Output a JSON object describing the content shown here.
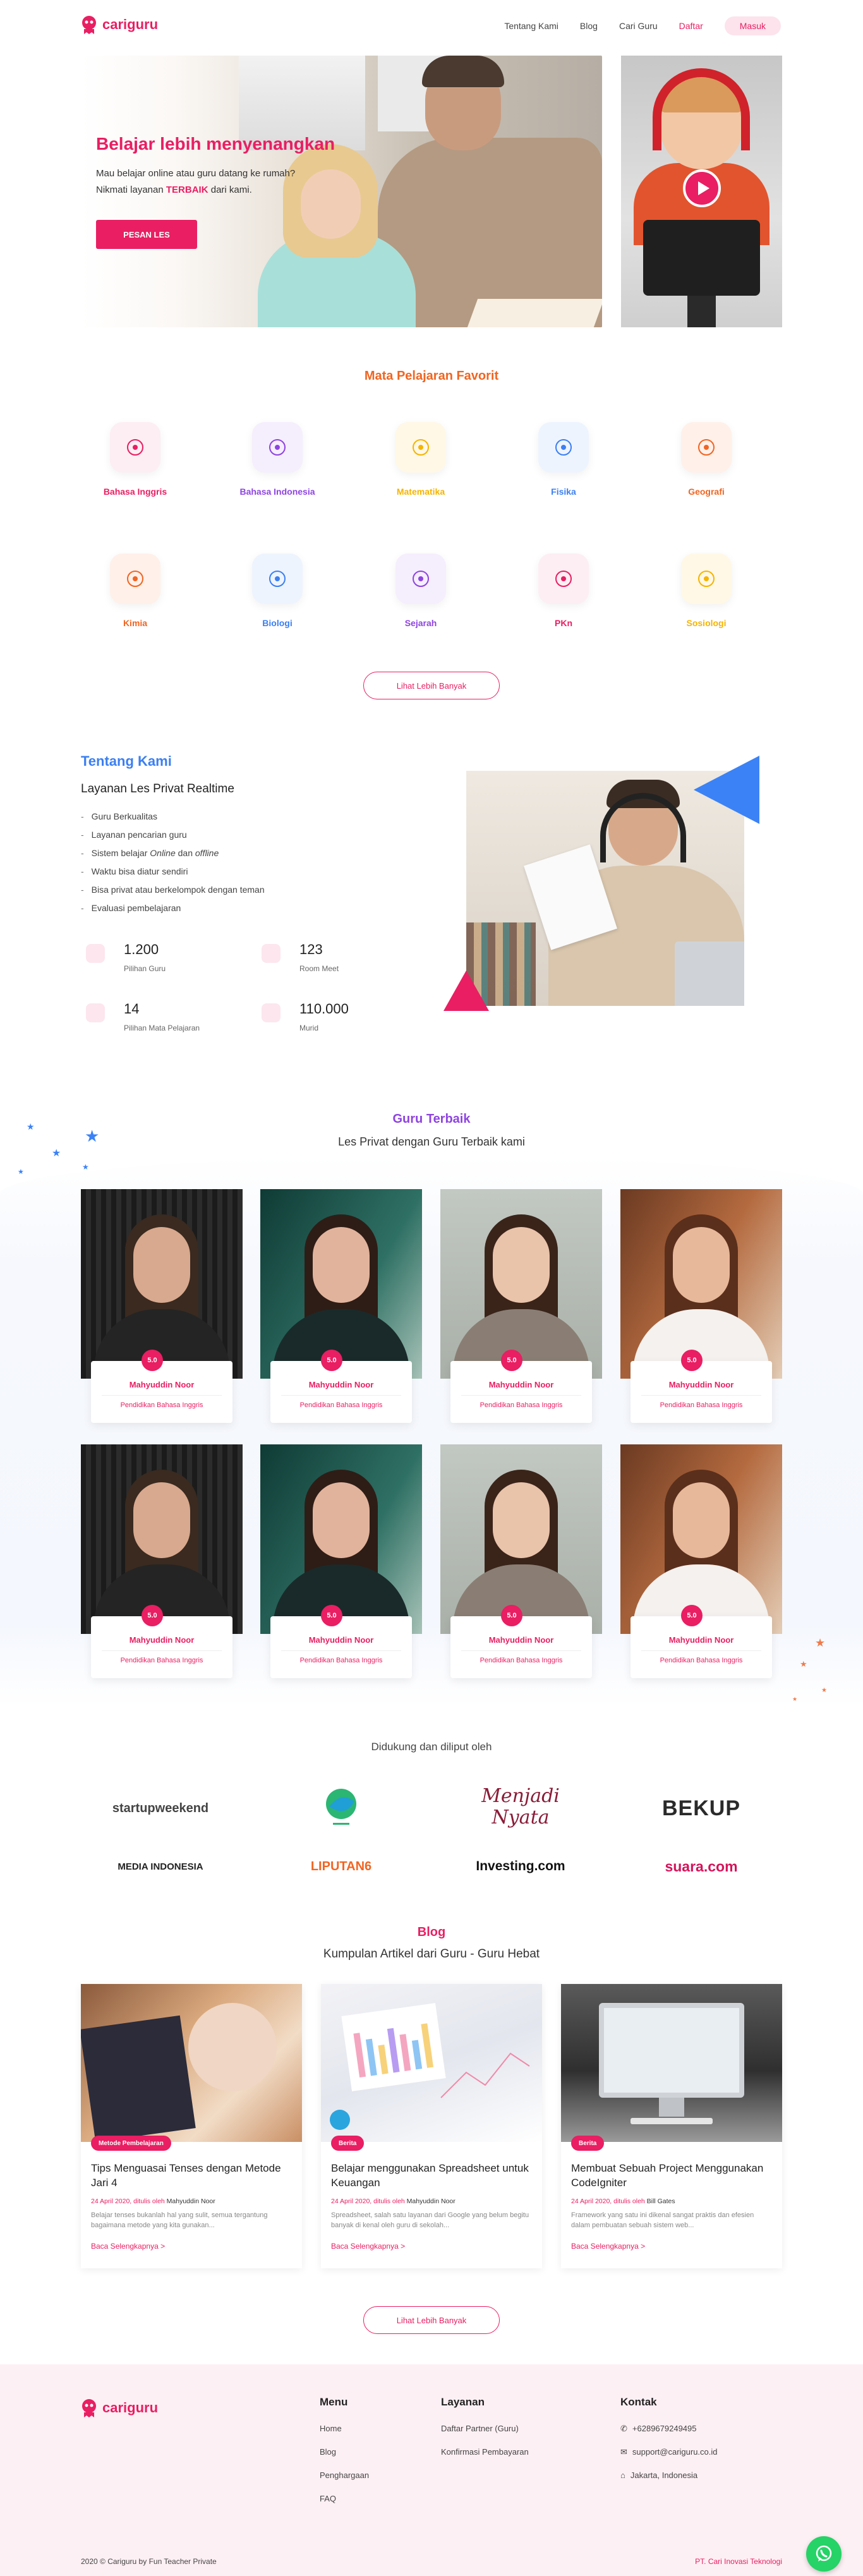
{
  "brand": {
    "name": "cariguru",
    "color": "#e91e63"
  },
  "nav": {
    "items": [
      "Tentang Kami",
      "Blog",
      "Cari Guru"
    ],
    "daftar": "Daftar",
    "masuk": "Masuk"
  },
  "hero": {
    "title": "Belajar lebih menyenangkan",
    "line1": "Mau belajar online atau guru datang ke rumah?",
    "line2_pre": "Nikmati layanan ",
    "line2_bold": "TERBAIK",
    "line2_post": " dari kami.",
    "button": "PESAN LES"
  },
  "video": {
    "play_icon": "play-icon"
  },
  "subjects": {
    "title": "Mata Pelajaran Favorit",
    "items": [
      {
        "label": "Bahasa Inggris",
        "icon": "english-bubble-icon",
        "color": "#e91e63",
        "bg": "#fdeef3"
      },
      {
        "label": "Bahasa Indonesia",
        "icon": "indonesia-bubble-icon",
        "color": "#8e44e0",
        "bg": "#f5eefd"
      },
      {
        "label": "Matematika",
        "icon": "calculator-icon",
        "color": "#f5b400",
        "bg": "#fff8e6"
      },
      {
        "label": "Fisika",
        "icon": "atom-icon",
        "color": "#3b7ff2",
        "bg": "#eef4fe"
      },
      {
        "label": "Geografi",
        "icon": "globe-icon",
        "color": "#f06522",
        "bg": "#fff0e9"
      },
      {
        "label": "Kimia",
        "icon": "flask-icon",
        "color": "#f06522",
        "bg": "#fff0e9"
      },
      {
        "label": "Biologi",
        "icon": "dna-icon",
        "color": "#3b7ff2",
        "bg": "#eef4fe"
      },
      {
        "label": "Sejarah",
        "icon": "history-search-icon",
        "color": "#8e44e0",
        "bg": "#f5eefd"
      },
      {
        "label": "PKn",
        "icon": "garuda-icon",
        "color": "#e91e63",
        "bg": "#fdeef3"
      },
      {
        "label": "Sosiologi",
        "icon": "network-icon",
        "color": "#f5b400",
        "bg": "#fff8e6"
      }
    ],
    "more": "Lihat Lebih Banyak"
  },
  "about": {
    "kicker": "Tentang Kami",
    "title": "Layanan Les Privat Realtime",
    "list": [
      "Guru Berkualitas",
      "Layanan pencarian guru",
      "Sistem belajar Online dan offline",
      "Waktu bisa diatur sendiri",
      "Bisa privat atau berkelompok dengan teman",
      "Evaluasi pembelajaran"
    ],
    "stats": [
      {
        "num": "1.200",
        "cap": "Pilihan Guru",
        "icon": "teacher-icon"
      },
      {
        "num": "123",
        "cap": "Room Meet",
        "icon": "room-icon"
      },
      {
        "num": "14",
        "cap": "Pilihan Mata Pelajaran",
        "icon": "board-icon"
      },
      {
        "num": "110.000",
        "cap": "Murid",
        "icon": "graduation-cap-icon"
      }
    ]
  },
  "teachers": {
    "title": "Guru Terbaik",
    "subtitle": "Les Privat dengan Guru Terbaik kami",
    "cards": [
      {
        "name": "Mahyuddin Noor",
        "subject": "Pendidikan Bahasa Inggris",
        "rating": "5.0"
      },
      {
        "name": "Mahyuddin Noor",
        "subject": "Pendidikan Bahasa Inggris",
        "rating": "5.0"
      },
      {
        "name": "Mahyuddin Noor",
        "subject": "Pendidikan Bahasa Inggris",
        "rating": "5.0"
      },
      {
        "name": "Mahyuddin Noor",
        "subject": "Pendidikan Bahasa Inggris",
        "rating": "5.0"
      },
      {
        "name": "Mahyuddin Noor",
        "subject": "Pendidikan Bahasa Inggris",
        "rating": "5.0"
      },
      {
        "name": "Mahyuddin Noor",
        "subject": "Pendidikan Bahasa Inggris",
        "rating": "5.0"
      },
      {
        "name": "Mahyuddin Noor",
        "subject": "Pendidikan Bahasa Inggris",
        "rating": "5.0"
      },
      {
        "name": "Mahyuddin Noor",
        "subject": "Pendidikan Bahasa Inggris",
        "rating": "5.0"
      }
    ]
  },
  "partners": {
    "title": "Didukung dan diliput oleh",
    "items": [
      "startupweekend",
      "Menjadi Nyata",
      "BEKUP",
      "MEDIA INDONESIA",
      "LIPUTAN6",
      "Investing.com",
      "suara.com"
    ]
  },
  "blog": {
    "kicker": "Blog",
    "subtitle": "Kumpulan Artikel dari Guru - Guru Hebat",
    "posts": [
      {
        "tag": "Metode Pembelajaran",
        "title": "Tips Menguasai Tenses dengan Metode Jari 4",
        "date": "24 April 2020, ditulis oleh ",
        "author": "Mahyuddin Noor",
        "excerpt": "Belajar tenses bukanlah hal yang sulit, semua tergantung bagaimana metode yang kita gunakan...",
        "more": "Baca Selengkapnya >"
      },
      {
        "tag": "Berita",
        "title": "Belajar menggunakan Spreadsheet untuk Keuangan",
        "date": "24 April 2020, ditulis oleh ",
        "author": "Mahyuddin Noor",
        "excerpt": "Spreadsheet, salah satu layanan dari Google yang belum begitu banyak di kenal oleh guru di sekolah...",
        "more": "Baca Selengkapnya >"
      },
      {
        "tag": "Berita",
        "title": "Membuat Sebuah Project Menggunakan CodeIgniter",
        "date": "24 April 2020, ditulis oleh ",
        "author": "Bill Gates",
        "excerpt": "Framework yang satu ini dikenal sangat praktis dan efesien dalam pembuatan sebuah sistem web...",
        "more": "Baca Selengkapnya >"
      }
    ],
    "more": "Lihat Lebih Banyak"
  },
  "footer": {
    "menu_title": "Menu",
    "menu": [
      "Home",
      "Blog",
      "Penghargaan",
      "FAQ"
    ],
    "layanan_title": "Layanan",
    "layanan": [
      "Daftar Partner (Guru)",
      "Konfirmasi Pembayaran"
    ],
    "kontak_title": "Kontak",
    "kontak": [
      {
        "icon": "phone-icon",
        "text": "+6289679249495"
      },
      {
        "icon": "mail-icon",
        "text": "support@cariguru.co.id"
      },
      {
        "icon": "home-icon",
        "text": "Jakarta, Indonesia"
      }
    ],
    "copyright": "2020 © Cariguru by Fun Teacher Private",
    "company": "PT. Cari Inovasi Teknologi"
  }
}
